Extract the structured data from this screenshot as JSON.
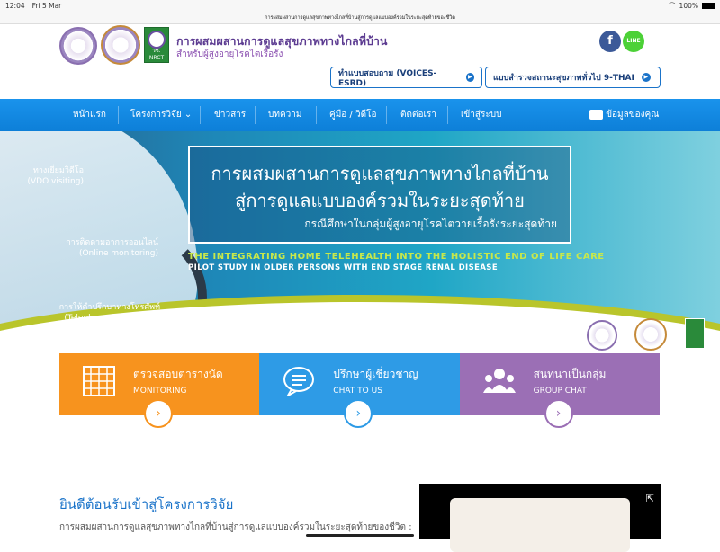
{
  "status_bar": {
    "time": "12:04",
    "date": "Fri 5 Mar",
    "battery": "100%"
  },
  "url_bar": {
    "text": "การผสมผสานการดูแลสุขภาพทางไกลที่บ้านสู่การดูแลแบบองค์รวมในระยะสุดท้ายของชีวิต"
  },
  "header": {
    "logo_badge": "วช. NRCT",
    "title": "การผสมผสานการดูแลสุขภาพทางไกลที่บ้าน",
    "subtitle": "สำหรับผู้สูงอายุโรคไตเรื้อรัง",
    "social": [
      {
        "name": "facebook-icon",
        "glyph": "f",
        "color": "#3b5998"
      },
      {
        "name": "line-icon",
        "glyph": "LINE",
        "color": "#4cd137"
      }
    ],
    "buttons": [
      {
        "label": "ทำแบบสอบถาม (VOICES-ESRD)"
      },
      {
        "label": "แบบสำรวจสถานะสุขภาพทั่วไป 9-THAI"
      }
    ]
  },
  "nav": {
    "items": [
      "หน้าแรก",
      "โครงการวิจัย",
      "ข่าวสาร",
      "บทความ",
      "คู่มือ / วิดีโอ",
      "ติดต่อเรา",
      "เข้าสู่ระบบ"
    ],
    "profile": "ข้อมูลของคุณ"
  },
  "banner": {
    "side_links": [
      {
        "th": "ทางเยี่ยมวิดีโอ",
        "en": "(VDO visiting)"
      },
      {
        "th": "การติดตามอาการออนไลน์",
        "en": "(Online monitoring)"
      },
      {
        "th": "การให้คำปรึกษาทางโทรศัพท์",
        "en": "(Telephone counselling)"
      }
    ],
    "headline_1": "การผสมผสานการดูแลสุขภาพทางไกลที่บ้าน",
    "headline_2": "สู่การดูแลแบบองค์รวมในระยะสุดท้าย",
    "headline_3": "กรณีศึกษาในกลุ่มผู้สูงอายุโรคไตวายเรื้อรังระยะสุดท้าย",
    "english_1": "THE INTEGRATING HOME TELEHEALTH INTO THE HOLISTIC END OF LIFE CARE",
    "english_2": "PILOT STUDY IN OLDER PERSONS WITH END STAGE RENAL DISEASE"
  },
  "cards": [
    {
      "title": "ตรวจสอบตารางนัด",
      "sub": "MONITORING",
      "color": "#f7931e",
      "icon": "calendar-grid-icon"
    },
    {
      "title": "ปรึกษาผู้เชี่ยวชาญ",
      "sub": "CHAT TO US",
      "color": "#2e9be6",
      "icon": "chat-bubble-icon"
    },
    {
      "title": "สนทนาเป็นกลุ่ม",
      "sub": "GROUP CHAT",
      "color": "#9b6fb5",
      "icon": "group-people-icon"
    }
  ],
  "welcome": {
    "title": "ยินดีต้อนรับเข้าสู่โครงการวิจัย",
    "subtitle": "การผสมผสานการดูแลสุขภาพทางไกลที่บ้านสู่การดูแลแบบองค์รวมในระยะสุดท้ายของชีวิต :"
  }
}
